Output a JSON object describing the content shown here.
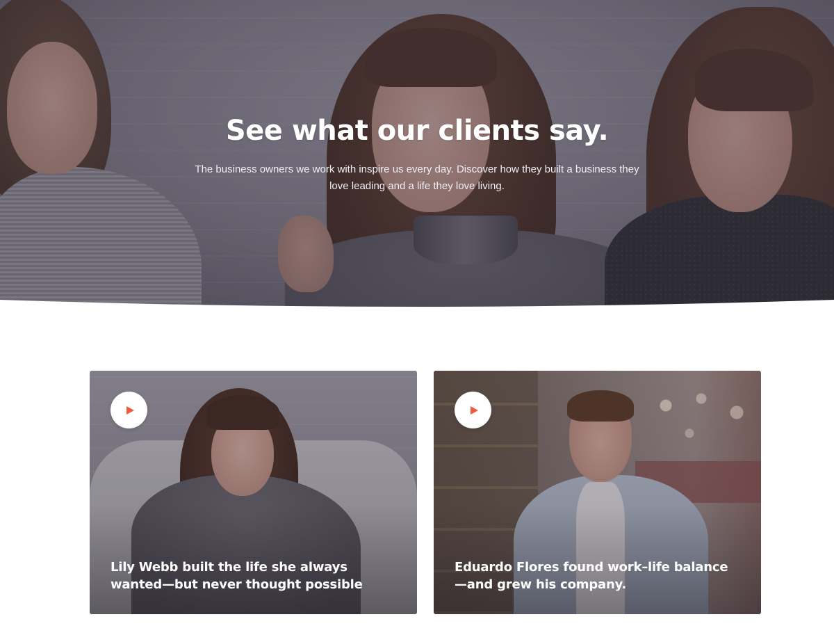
{
  "hero": {
    "title": "See what our clients say.",
    "subtitle": "The business owners we work with inspire us every day. Discover how they built a business they love leading and a life they love living."
  },
  "testimonials": [
    {
      "caption": "Lily Webb built the life she always wanted—but never thought possible",
      "icon": "play-icon"
    },
    {
      "caption": "Eduardo Flores found work–life balance—and grew his company.",
      "icon": "play-icon"
    }
  ],
  "colors": {
    "accent": "#ef5a3c",
    "overlay": "#302c3c",
    "background": "#ffffff"
  }
}
